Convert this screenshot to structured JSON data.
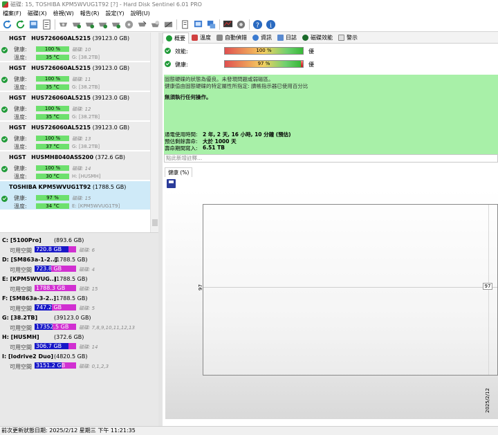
{
  "window": {
    "title": "磁碟: 15, TOSHIBA KPM5WVUG1T92 [?]  -  Hard Disk Sentinel 6.01 PRO"
  },
  "menu": [
    "檔案(F)",
    "磁碟(X)",
    "檢視(W)",
    "報告(R)",
    "設定(Y)",
    "說明(U)"
  ],
  "toolbar": {
    "icons": [
      "refresh-icon",
      "refresh-all-icon",
      "surface-test-icon",
      "report-icon",
      "disk-icon-1",
      "disk-icon-2",
      "disk-icon-3",
      "disk-icon-4",
      "disk-icon-5",
      "disk-icon-6",
      "disk-icon-7",
      "disk-icon-8",
      "disk-icon-9",
      "copy-icon",
      "alert-icon",
      "network-icon",
      "monitor-icon",
      "settings-icon",
      "help-icon",
      "info-icon"
    ]
  },
  "disks": [
    {
      "model": "HGST",
      "name": "HUS726060AL5215",
      "size": "(39123.0 GB)",
      "health": "100 %",
      "temp": "35 °C",
      "health_extra": "磁碟: 10",
      "temp_extra": "G: [38.2TB]"
    },
    {
      "model": "HGST",
      "name": "HUS726060AL5215",
      "size": "(39123.0 GB)",
      "health": "100 %",
      "temp": "35 °C",
      "health_extra": "磁碟: 11",
      "temp_extra": "G: [38.2TB]"
    },
    {
      "model": "HGST",
      "name": "HUS726060AL5215",
      "size": "(39123.0 GB)",
      "health": "100 %",
      "temp": "35 °C",
      "health_extra": "磁碟: 12",
      "temp_extra": "G: [38.2TB]"
    },
    {
      "model": "HGST",
      "name": "HUS726060AL5215",
      "size": "(39123.0 GB)",
      "health": "100 %",
      "temp": "37 °C",
      "health_extra": "磁碟: 13",
      "temp_extra": "G: [38.2TB]"
    },
    {
      "model": "HGST",
      "name": "HUSMH8040ASS200",
      "size": "(372.6 GB)",
      "health": "100 %",
      "temp": "30 °C",
      "health_extra": "磁碟: 14",
      "temp_extra": "H: [HUSMH]"
    },
    {
      "model": "TOSHIBA",
      "name": "KPM5WVUG1T92",
      "size": "(1788.5 GB)",
      "health": "97 %",
      "temp": "34 °C",
      "health_extra": "磁碟: 15",
      "temp_extra": "E: [KPM5WVUG1T9]"
    }
  ],
  "disk_labels": {
    "health": "健康:",
    "temp": "溫度:"
  },
  "volumes": [
    {
      "name": "C: [5100Pro]",
      "size": "(893.6 GB)",
      "free": "720.8 GB",
      "disk": "磁碟: 6",
      "used_fraction": 0.81
    },
    {
      "name": "D: [SM863a-1-2..]",
      "size": "(1788.5 GB)",
      "free": "723.8 GB",
      "disk": "磁碟: 4",
      "used_fraction": 0.4
    },
    {
      "name": "E: [KPM5WVUG..]",
      "size": "(1788.5 GB)",
      "free": "1788.3 GB",
      "disk": "磁碟: 15",
      "used_fraction": 0.0
    },
    {
      "name": "F: [SM863a-3-2..]",
      "size": "(1788.5 GB)",
      "free": "747.2 GB",
      "disk": "磁碟: 5",
      "used_fraction": 0.42
    },
    {
      "name": "G: [38.2TB]",
      "size": "(39123.0 GB)",
      "free": "17352.5 GB",
      "disk": "磁碟: 7,8,9,10,11,12,13",
      "used_fraction": 0.44
    },
    {
      "name": "H: [HUSMH]",
      "size": "(372.6 GB)",
      "free": "306.7 GB",
      "disk": "磁碟: 14",
      "used_fraction": 0.82
    },
    {
      "name": "I: [Iodrive2 Duo]",
      "size": "(4820.5 GB)",
      "free": "3151.2 GB",
      "disk": "磁碟: 0,1,2,3",
      "used_fraction": 0.65
    }
  ],
  "volume_free_label": "可用空間",
  "tabs": [
    "概要",
    "溫度",
    "自動偵錯",
    "資訊",
    "日誌",
    "磁碟效能",
    "警示"
  ],
  "metrics": {
    "performance": {
      "label": "效能:",
      "value": "100 %",
      "grade": "優",
      "fraction": 1.0
    },
    "health": {
      "label": "健康:",
      "value": "97 %",
      "grade": "優",
      "fraction": 0.97
    }
  },
  "status": {
    "line1": "固態硬碟的狀態為優良。未發現問題或弱磁區。",
    "line2": "健康值由固態硬碟的特定屬性所指定: 讀帳指示器已使用百分比",
    "advice": "無須執行任何操作。"
  },
  "info": {
    "power_on_label": "通電使用時間:",
    "power_on_value": "2 年, 2 天, 16 小時, 10 分鐘 (預估)",
    "remaining_label": "預估剩餘壽命:",
    "remaining_value": "大於 1000 天",
    "tbw_label": "壽命期間寫入:",
    "tbw_value": "6.51 TB"
  },
  "notes_placeholder": "點此新增註釋...",
  "chart_tab": "健康 (%)",
  "chart_data": {
    "type": "line",
    "x": [
      "2025/2/12"
    ],
    "series": [
      {
        "values": [
          97
        ]
      }
    ],
    "y_tick_labels": [
      "97"
    ]
  },
  "statusbar": "前次更新狀態日期: 2025/2/12 星期三 下午 11:21:35"
}
